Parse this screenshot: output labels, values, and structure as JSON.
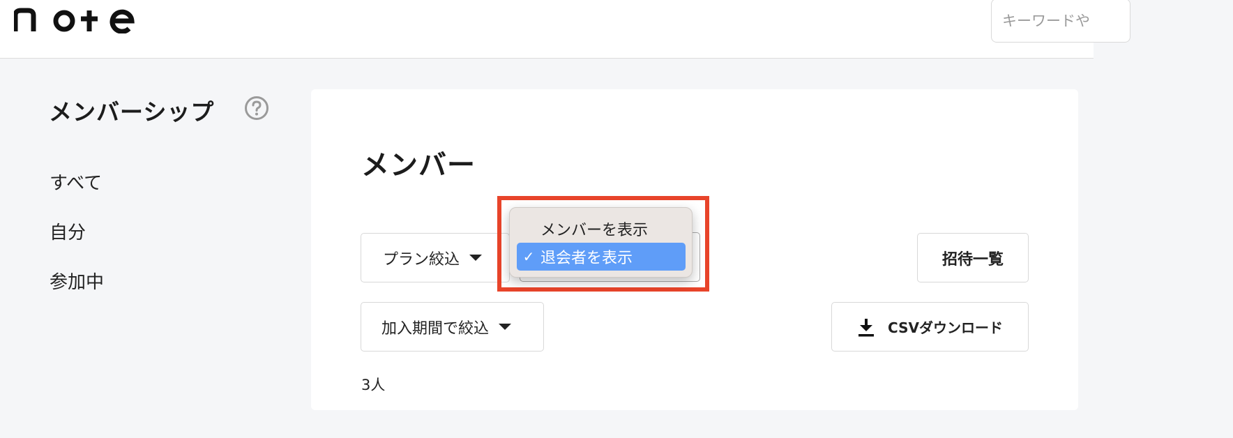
{
  "header": {
    "logo_text": "note",
    "search_placeholder": "キーワードや"
  },
  "sidebar": {
    "title": "メンバーシップ",
    "items": [
      {
        "label": "すべて"
      },
      {
        "label": "自分"
      },
      {
        "label": "参加中"
      }
    ]
  },
  "main": {
    "title": "メンバー",
    "plan_filter_label": "プラン絞込",
    "period_filter_label": "加入期間で絞込",
    "invites_button_label": "招待一覧",
    "csv_button_label": "CSVダウンロード",
    "member_count": "3人"
  },
  "dropdown": {
    "options": [
      {
        "label": "メンバーを表示",
        "selected": false
      },
      {
        "label": "退会者を表示",
        "selected": true
      }
    ],
    "check_mark": "✓"
  },
  "colors": {
    "highlight": "#e8442a",
    "selected_option": "#5f9df8"
  }
}
